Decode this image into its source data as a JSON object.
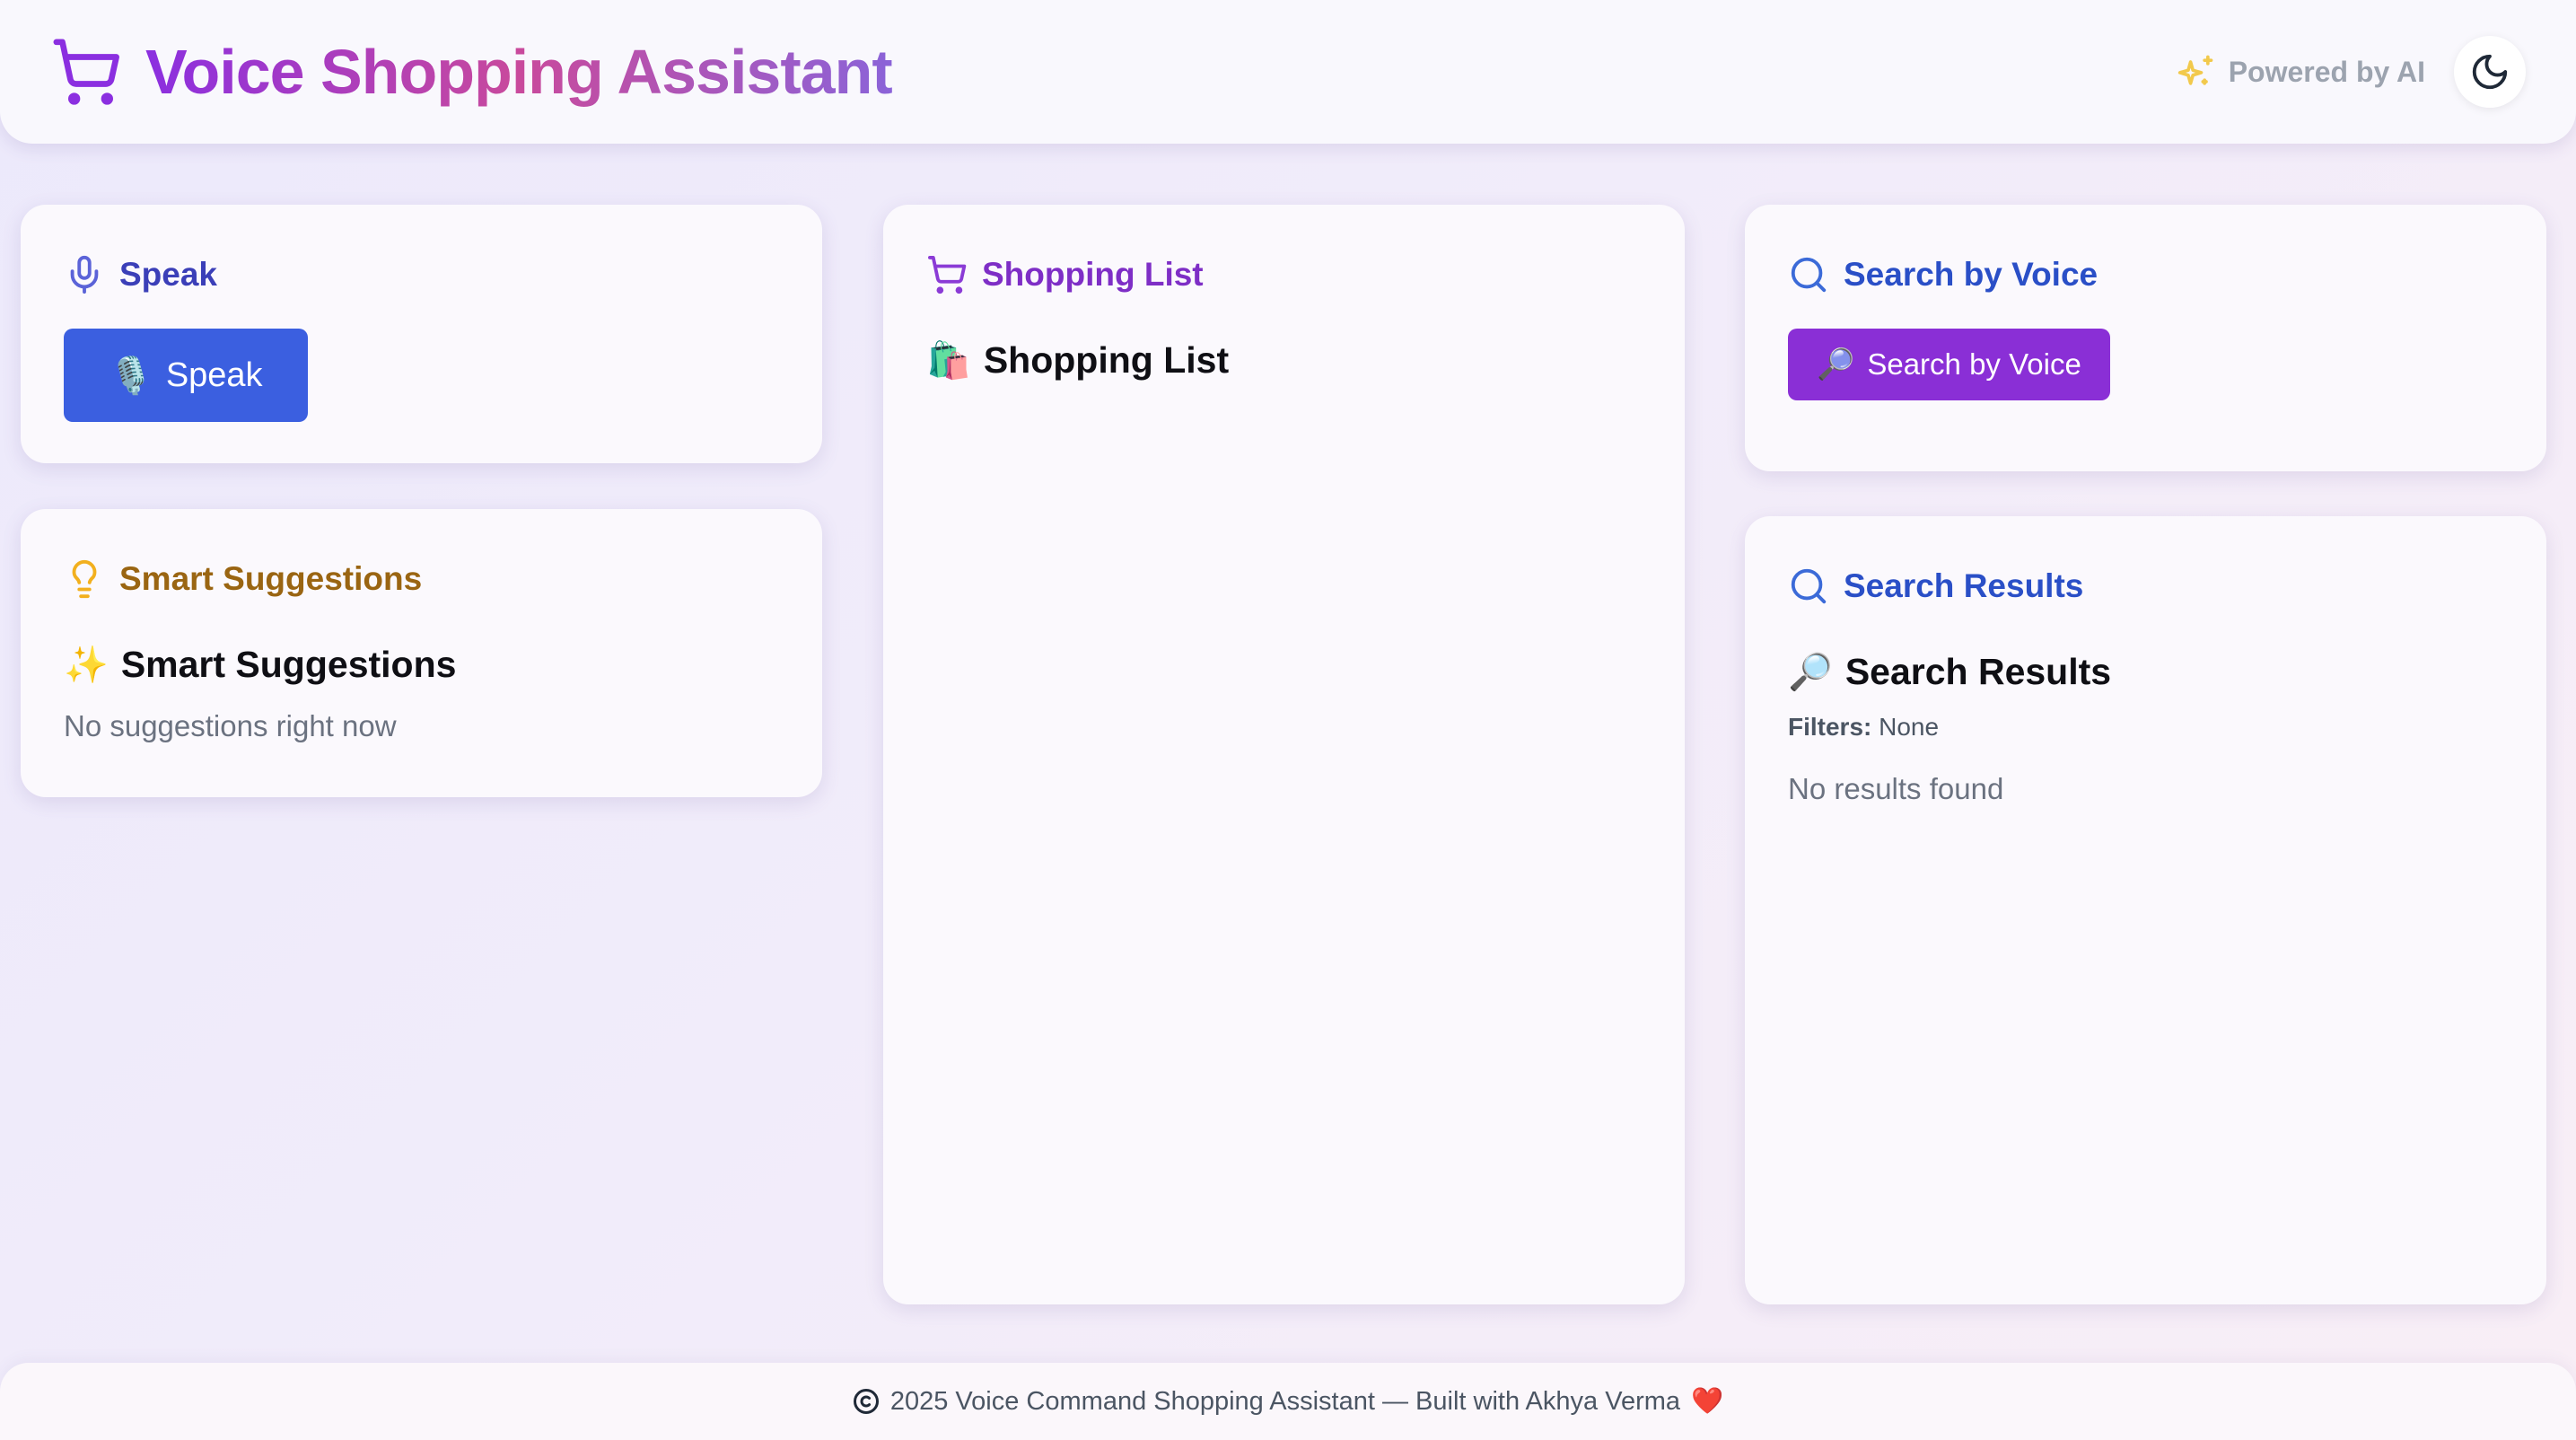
{
  "header": {
    "title": "Voice Shopping Assistant",
    "powered_by": "Powered by AI",
    "brand_icon": "shopping-cart-icon",
    "powered_icon": "sparkles-icon",
    "theme_icon": "moon-icon",
    "brand_color": "#8b2fe0"
  },
  "speak_card": {
    "heading": "Speak",
    "heading_icon": "microphone-icon",
    "heading_color": "#3b3fb8",
    "button_emoji": "🎙️",
    "button_label": "Speak",
    "button_color": "#3b5fe0"
  },
  "suggestions_card": {
    "heading": "Smart Suggestions",
    "heading_icon": "lightbulb-icon",
    "heading_color": "#9a6512",
    "subtitle_emoji": "✨",
    "subtitle": "Smart Suggestions",
    "empty_text": "No suggestions right now"
  },
  "shopping_card": {
    "heading": "Shopping List",
    "heading_icon": "shopping-cart-icon",
    "heading_color": "#7e2ec6",
    "subtitle_emoji": "🛍️",
    "subtitle": "Shopping List"
  },
  "search_voice_card": {
    "heading": "Search by Voice",
    "heading_icon": "search-icon",
    "heading_color": "#2a4fc7",
    "button_emoji": "🔎",
    "button_label": "Search by Voice",
    "button_color": "#8a2fd6"
  },
  "results_card": {
    "heading": "Search Results",
    "heading_icon": "search-icon",
    "heading_color": "#2a4fc7",
    "subtitle_emoji": "🔎",
    "subtitle": "Search Results",
    "filters_label": "Filters:",
    "filters_value": "None",
    "empty_text": "No results found"
  },
  "footer": {
    "text": "2025 Voice Command Shopping Assistant — Built with Akhya Verma",
    "heart": "❤️",
    "icon": "copyright-icon"
  }
}
